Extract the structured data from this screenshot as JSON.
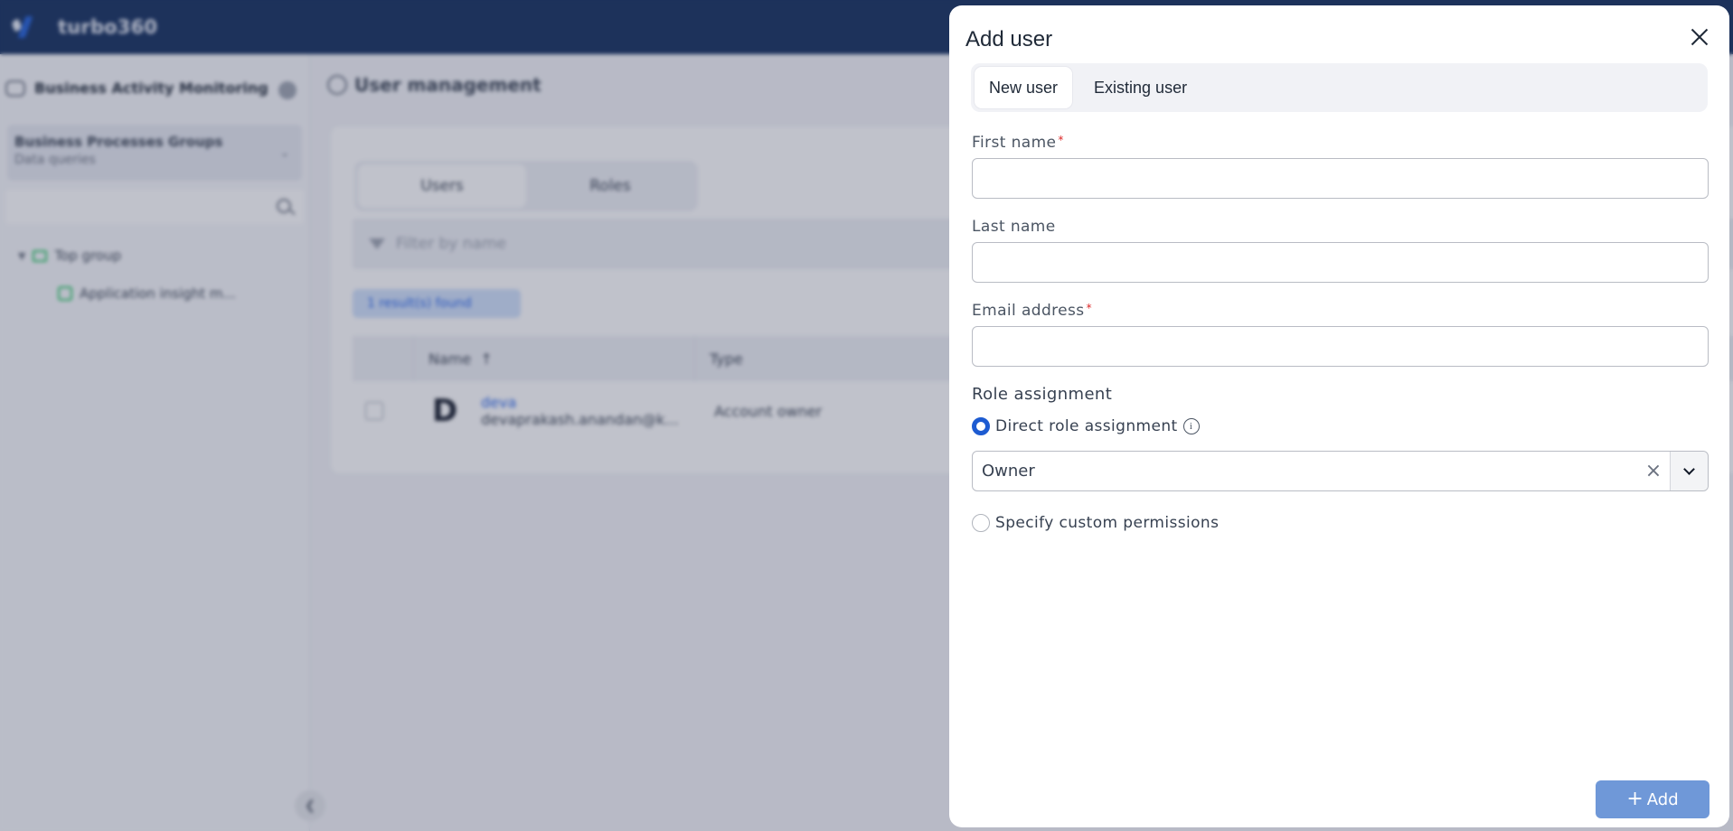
{
  "app": {
    "brand": "turbo360"
  },
  "sidebar": {
    "title": "Business Activity Monitoring",
    "group": {
      "name": "Business Processes Groups",
      "subtitle": "Data queries"
    },
    "search": {
      "placeholder": ""
    },
    "tree": [
      {
        "label": "Top group",
        "expanded": true
      },
      {
        "label": "Application insight m..."
      }
    ]
  },
  "main": {
    "title": "User management",
    "tabs": [
      {
        "label": "Users",
        "active": true
      },
      {
        "label": "Roles",
        "active": false
      }
    ],
    "filter": {
      "placeholder": "Filter by name"
    },
    "results_badge": "1 result(s) found",
    "table": {
      "columns": [
        "Name",
        "Type"
      ],
      "sort": "Name ascending",
      "rows": [
        {
          "avatar": "D",
          "name": "deva",
          "email": "devaprakash.anandan@k...",
          "type": "Account owner"
        }
      ]
    }
  },
  "modal": {
    "title": "Add user",
    "tabs": [
      {
        "label": "New user",
        "active": true
      },
      {
        "label": "Existing user",
        "active": false
      }
    ],
    "fields": {
      "first_name": {
        "label": "First name",
        "required": true,
        "value": ""
      },
      "last_name": {
        "label": "Last name",
        "required": false,
        "value": ""
      },
      "email": {
        "label": "Email address",
        "required": true,
        "value": ""
      }
    },
    "role_assignment": {
      "title": "Role assignment",
      "options": [
        {
          "label": "Direct role assignment",
          "selected": true
        },
        {
          "label": "Specify custom permissions",
          "selected": false
        }
      ],
      "role_select": {
        "value": "Owner"
      }
    },
    "add_button": {
      "label": "Add",
      "icon": "plus-icon"
    }
  },
  "colors": {
    "header_bg": "#0f2b5b",
    "accent": "#1d5bd1",
    "add_button_bg": "#6f98d8",
    "required": "#dc2626"
  }
}
